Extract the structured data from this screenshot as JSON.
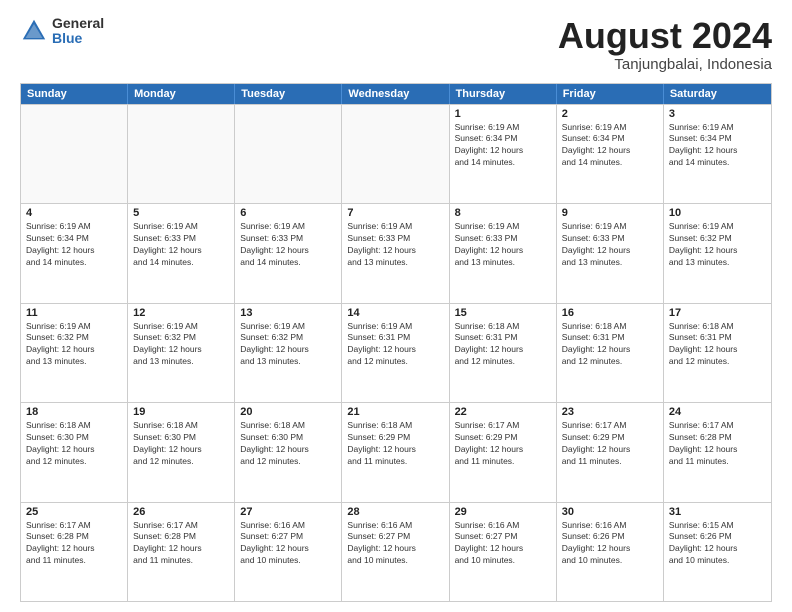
{
  "header": {
    "logo": {
      "line1": "General",
      "line2": "Blue"
    },
    "title": "August 2024",
    "subtitle": "Tanjungbalai, Indonesia"
  },
  "weekdays": [
    "Sunday",
    "Monday",
    "Tuesday",
    "Wednesday",
    "Thursday",
    "Friday",
    "Saturday"
  ],
  "weeks": [
    [
      {
        "day": "",
        "info": ""
      },
      {
        "day": "",
        "info": ""
      },
      {
        "day": "",
        "info": ""
      },
      {
        "day": "",
        "info": ""
      },
      {
        "day": "1",
        "info": "Sunrise: 6:19 AM\nSunset: 6:34 PM\nDaylight: 12 hours\nand 14 minutes."
      },
      {
        "day": "2",
        "info": "Sunrise: 6:19 AM\nSunset: 6:34 PM\nDaylight: 12 hours\nand 14 minutes."
      },
      {
        "day": "3",
        "info": "Sunrise: 6:19 AM\nSunset: 6:34 PM\nDaylight: 12 hours\nand 14 minutes."
      }
    ],
    [
      {
        "day": "4",
        "info": "Sunrise: 6:19 AM\nSunset: 6:34 PM\nDaylight: 12 hours\nand 14 minutes."
      },
      {
        "day": "5",
        "info": "Sunrise: 6:19 AM\nSunset: 6:33 PM\nDaylight: 12 hours\nand 14 minutes."
      },
      {
        "day": "6",
        "info": "Sunrise: 6:19 AM\nSunset: 6:33 PM\nDaylight: 12 hours\nand 14 minutes."
      },
      {
        "day": "7",
        "info": "Sunrise: 6:19 AM\nSunset: 6:33 PM\nDaylight: 12 hours\nand 13 minutes."
      },
      {
        "day": "8",
        "info": "Sunrise: 6:19 AM\nSunset: 6:33 PM\nDaylight: 12 hours\nand 13 minutes."
      },
      {
        "day": "9",
        "info": "Sunrise: 6:19 AM\nSunset: 6:33 PM\nDaylight: 12 hours\nand 13 minutes."
      },
      {
        "day": "10",
        "info": "Sunrise: 6:19 AM\nSunset: 6:32 PM\nDaylight: 12 hours\nand 13 minutes."
      }
    ],
    [
      {
        "day": "11",
        "info": "Sunrise: 6:19 AM\nSunset: 6:32 PM\nDaylight: 12 hours\nand 13 minutes."
      },
      {
        "day": "12",
        "info": "Sunrise: 6:19 AM\nSunset: 6:32 PM\nDaylight: 12 hours\nand 13 minutes."
      },
      {
        "day": "13",
        "info": "Sunrise: 6:19 AM\nSunset: 6:32 PM\nDaylight: 12 hours\nand 13 minutes."
      },
      {
        "day": "14",
        "info": "Sunrise: 6:19 AM\nSunset: 6:31 PM\nDaylight: 12 hours\nand 12 minutes."
      },
      {
        "day": "15",
        "info": "Sunrise: 6:18 AM\nSunset: 6:31 PM\nDaylight: 12 hours\nand 12 minutes."
      },
      {
        "day": "16",
        "info": "Sunrise: 6:18 AM\nSunset: 6:31 PM\nDaylight: 12 hours\nand 12 minutes."
      },
      {
        "day": "17",
        "info": "Sunrise: 6:18 AM\nSunset: 6:31 PM\nDaylight: 12 hours\nand 12 minutes."
      }
    ],
    [
      {
        "day": "18",
        "info": "Sunrise: 6:18 AM\nSunset: 6:30 PM\nDaylight: 12 hours\nand 12 minutes."
      },
      {
        "day": "19",
        "info": "Sunrise: 6:18 AM\nSunset: 6:30 PM\nDaylight: 12 hours\nand 12 minutes."
      },
      {
        "day": "20",
        "info": "Sunrise: 6:18 AM\nSunset: 6:30 PM\nDaylight: 12 hours\nand 12 minutes."
      },
      {
        "day": "21",
        "info": "Sunrise: 6:18 AM\nSunset: 6:29 PM\nDaylight: 12 hours\nand 11 minutes."
      },
      {
        "day": "22",
        "info": "Sunrise: 6:17 AM\nSunset: 6:29 PM\nDaylight: 12 hours\nand 11 minutes."
      },
      {
        "day": "23",
        "info": "Sunrise: 6:17 AM\nSunset: 6:29 PM\nDaylight: 12 hours\nand 11 minutes."
      },
      {
        "day": "24",
        "info": "Sunrise: 6:17 AM\nSunset: 6:28 PM\nDaylight: 12 hours\nand 11 minutes."
      }
    ],
    [
      {
        "day": "25",
        "info": "Sunrise: 6:17 AM\nSunset: 6:28 PM\nDaylight: 12 hours\nand 11 minutes."
      },
      {
        "day": "26",
        "info": "Sunrise: 6:17 AM\nSunset: 6:28 PM\nDaylight: 12 hours\nand 11 minutes."
      },
      {
        "day": "27",
        "info": "Sunrise: 6:16 AM\nSunset: 6:27 PM\nDaylight: 12 hours\nand 10 minutes."
      },
      {
        "day": "28",
        "info": "Sunrise: 6:16 AM\nSunset: 6:27 PM\nDaylight: 12 hours\nand 10 minutes."
      },
      {
        "day": "29",
        "info": "Sunrise: 6:16 AM\nSunset: 6:27 PM\nDaylight: 12 hours\nand 10 minutes."
      },
      {
        "day": "30",
        "info": "Sunrise: 6:16 AM\nSunset: 6:26 PM\nDaylight: 12 hours\nand 10 minutes."
      },
      {
        "day": "31",
        "info": "Sunrise: 6:15 AM\nSunset: 6:26 PM\nDaylight: 12 hours\nand 10 minutes."
      }
    ]
  ]
}
